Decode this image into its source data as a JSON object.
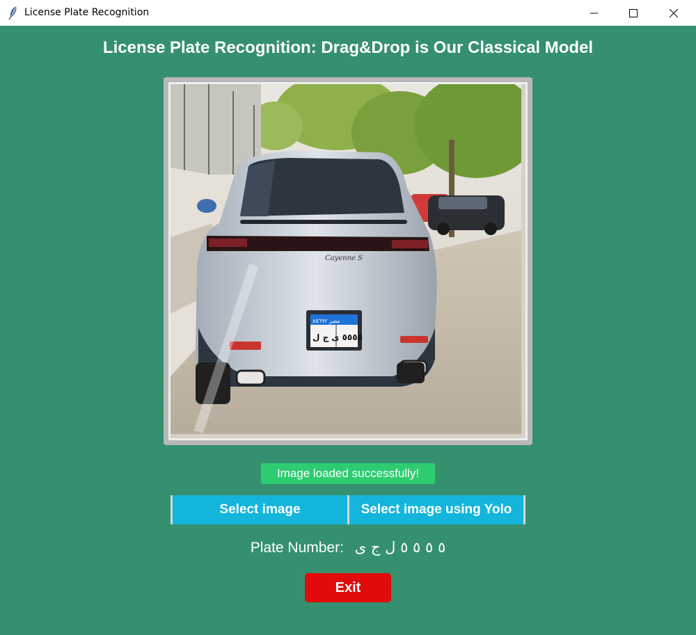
{
  "window": {
    "title": "License Plate Recognition",
    "app_icon": "feather-icon",
    "controls": [
      "minimize-icon",
      "maximize-icon",
      "close-icon"
    ]
  },
  "heading": "License Plate Recognition: Drag&Drop is Our Classical Model",
  "image": {
    "subject": "car-photo",
    "plate_top": "مصر ٨٥٦٩٢",
    "plate_bottom": "٥٥٥٥ ى ج ل"
  },
  "status": "Image loaded successfully!",
  "buttons": {
    "select_image": "Select image",
    "select_yolo": "Select image using Yolo",
    "exit": "Exit"
  },
  "plate": {
    "label": "Plate Number:",
    "value": "٥ ٥ ٥ ٥ ل ج ى"
  },
  "colors": {
    "background": "#35906f",
    "status_badge": "#2ecc71",
    "select_buttons": "#13b5db",
    "exit_button": "#e20b0b",
    "frame": "#b9b9b9"
  }
}
